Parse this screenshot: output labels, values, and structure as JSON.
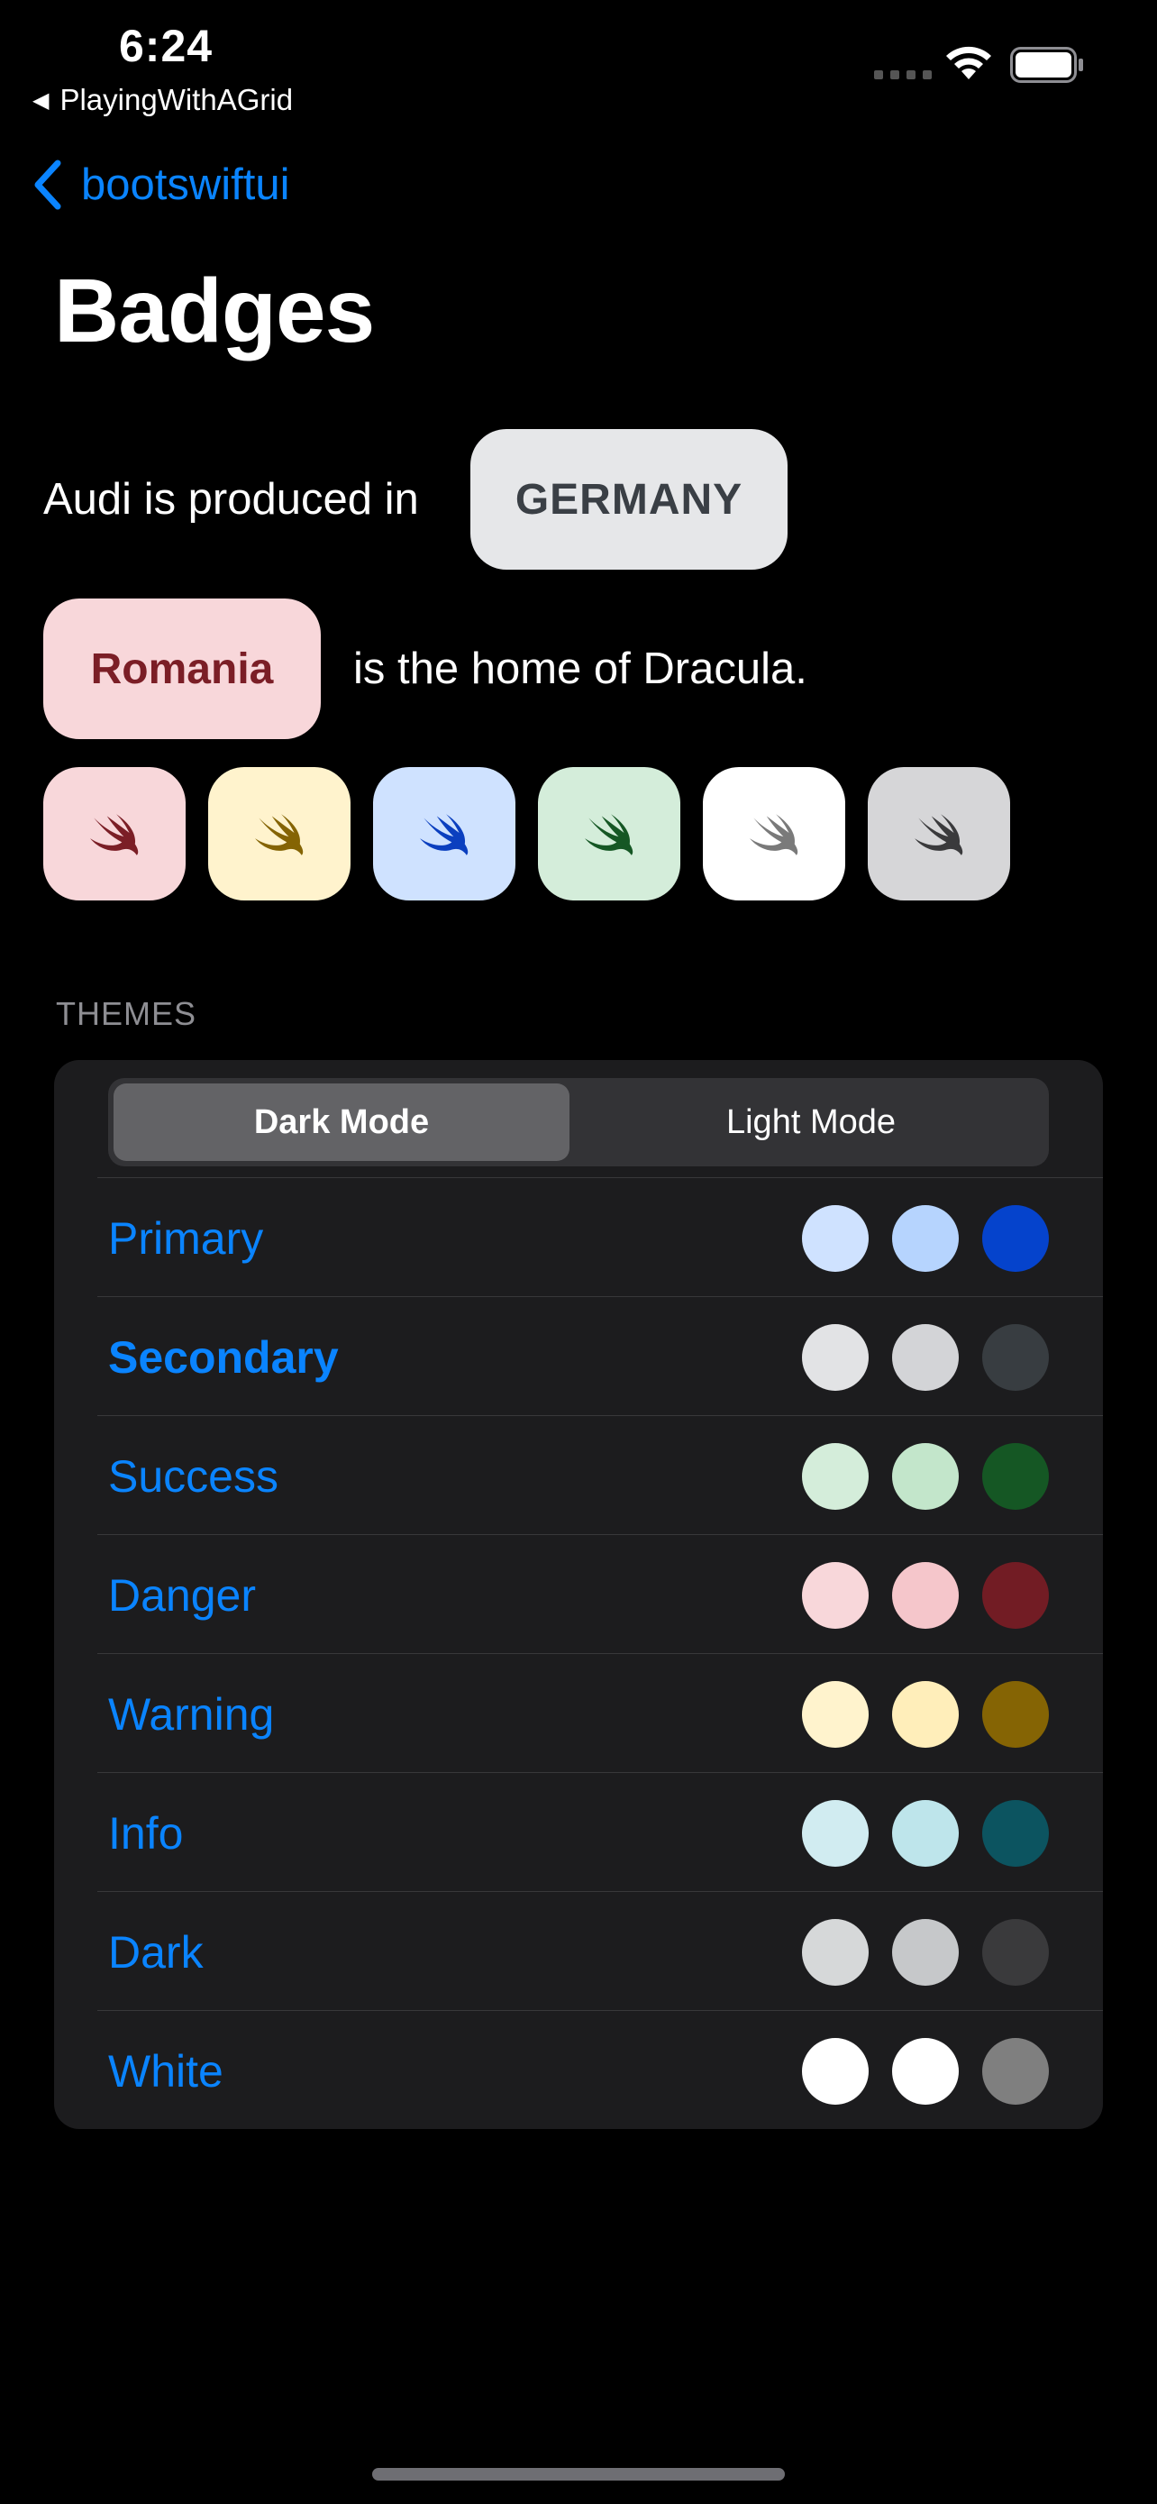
{
  "status_bar": {
    "time": "6:24",
    "back_app": "PlayingWithAGrid",
    "back_glyph": "◀"
  },
  "nav": {
    "back_label": "bootswiftui",
    "title": "Badges"
  },
  "badge_examples": {
    "line1_text": "Audi is produced in",
    "germany_badge": "GERMANY",
    "romania_badge": "Romania",
    "line2_text": "is the home of Dracula."
  },
  "icon_badges": [
    {
      "icon": "swift-icon",
      "bg": "#f8d7da",
      "fg": "#7b1e26"
    },
    {
      "icon": "swift-icon",
      "bg": "#fff3cd",
      "fg": "#856404"
    },
    {
      "icon": "swift-icon",
      "bg": "#cfe2ff",
      "fg": "#0b3fbf"
    },
    {
      "icon": "swift-icon",
      "bg": "#d4edda",
      "fg": "#155724"
    },
    {
      "icon": "swift-icon",
      "bg": "#ffffff",
      "fg": "#7a7a7a"
    },
    {
      "icon": "swift-icon",
      "bg": "#d6d6d8",
      "fg": "#3a3a3c"
    }
  ],
  "themes": {
    "header": "THEMES",
    "segments": {
      "dark": "Dark Mode",
      "light": "Light Mode",
      "selected": "Dark Mode"
    },
    "rows": [
      {
        "label": "Primary",
        "bold": false,
        "colors": [
          "#cfe2ff",
          "#b6d4fe",
          "#0543cc"
        ]
      },
      {
        "label": "Secondary",
        "bold": true,
        "colors": [
          "#e2e3e5",
          "#d3d4d7",
          "#383d41"
        ]
      },
      {
        "label": "Success",
        "bold": false,
        "colors": [
          "#d4edda",
          "#c3e6cb",
          "#155724"
        ]
      },
      {
        "label": "Danger",
        "bold": false,
        "colors": [
          "#f8d7da",
          "#f5c6cb",
          "#721c24"
        ]
      },
      {
        "label": "Warning",
        "bold": false,
        "colors": [
          "#fff3cd",
          "#ffeeba",
          "#856404"
        ]
      },
      {
        "label": "Info",
        "bold": false,
        "colors": [
          "#d1ecf1",
          "#bee5eb",
          "#0c5460"
        ]
      },
      {
        "label": "Dark",
        "bold": false,
        "colors": [
          "#d6d8d9",
          "#c6c8ca",
          "#3a3a3c"
        ]
      },
      {
        "label": "White",
        "bold": false,
        "colors": [
          "#ffffff",
          "#ffffff",
          "#7f7f7f"
        ]
      }
    ]
  }
}
